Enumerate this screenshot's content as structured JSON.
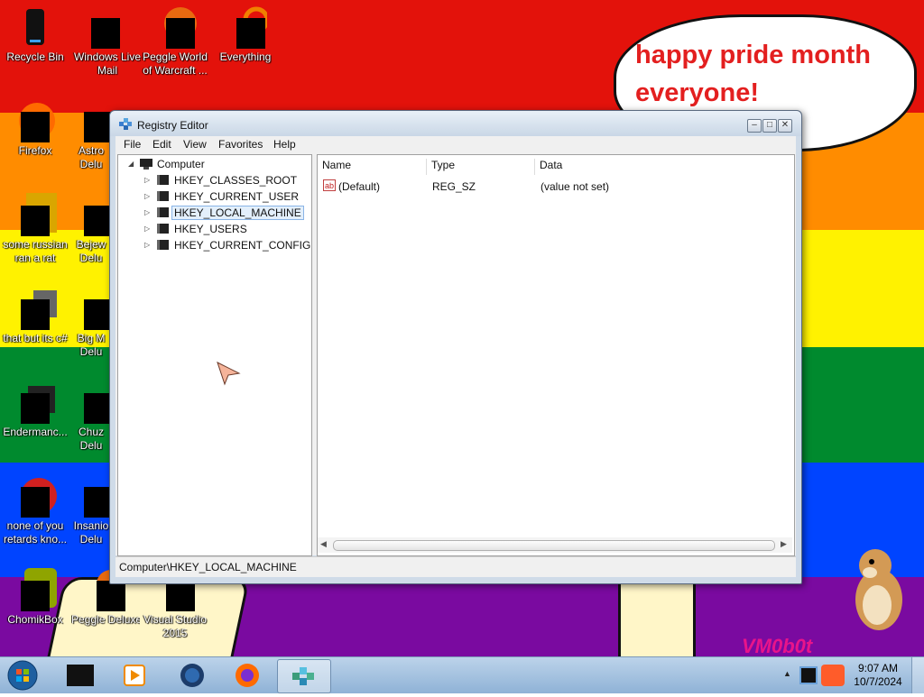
{
  "wallpaper": {
    "bubble_line1": "happy pride month",
    "bubble_line2": "everyone!",
    "signature": "VM0b0t",
    "colors": [
      "#e3120b",
      "#ff8c00",
      "#fff200",
      "#008a2e",
      "#0044ff",
      "#7a0aa0"
    ]
  },
  "desktop_icons": [
    {
      "label": "Recycle Bin",
      "icon": "recycle-bin-icon"
    },
    {
      "label": "Windows Live Mail",
      "icon": "windows-live-mail-icon"
    },
    {
      "label": "Peggle World of Warcraft ...",
      "icon": "peggle-icon"
    },
    {
      "label": "Everything",
      "icon": "everything-search-icon"
    },
    {
      "label": "Firefox",
      "icon": "firefox-icon"
    },
    {
      "label": "Astro Delu",
      "icon": "game-icon"
    },
    {
      "label": "some russian ran a rat",
      "icon": "ae-icon"
    },
    {
      "label": "Bejew Delu",
      "icon": "game-icon"
    },
    {
      "label": "that but its c#",
      "icon": "folder-stack-icon"
    },
    {
      "label": "Big M Delu",
      "icon": "game-icon"
    },
    {
      "label": "Endermanc...",
      "icon": "terminal-icon"
    },
    {
      "label": "Chuz Delu",
      "icon": "game-icon"
    },
    {
      "label": "none of you retards kno...",
      "icon": "app-icon"
    },
    {
      "label": "Insanio Delu",
      "icon": "game-icon"
    },
    {
      "label": "ChomikBox",
      "icon": "chomikbox-icon"
    },
    {
      "label": "Peggle Deluxe",
      "icon": "peggle-icon"
    },
    {
      "label": "Visual Studio 2015",
      "icon": "visual-studio-icon"
    }
  ],
  "window": {
    "title": "Registry Editor",
    "menu": [
      "File",
      "Edit",
      "View",
      "Favorites",
      "Help"
    ],
    "tree": {
      "root": "Computer",
      "children": [
        "HKEY_CLASSES_ROOT",
        "HKEY_CURRENT_USER",
        "HKEY_LOCAL_MACHINE",
        "HKEY_USERS",
        "HKEY_CURRENT_CONFIG"
      ],
      "selected": "HKEY_LOCAL_MACHINE"
    },
    "list": {
      "columns": [
        "Name",
        "Type",
        "Data"
      ],
      "rows": [
        {
          "name": "(Default)",
          "type": "REG_SZ",
          "data": "(value not set)"
        }
      ]
    },
    "status": "Computer\\HKEY_LOCAL_MACHINE"
  },
  "taskbar": {
    "items": [
      "start-orb",
      "terminal",
      "media-player",
      "globe",
      "firefox",
      "registry-editor"
    ],
    "active": "registry-editor",
    "time": "9:07 AM",
    "date": "10/7/2024"
  }
}
